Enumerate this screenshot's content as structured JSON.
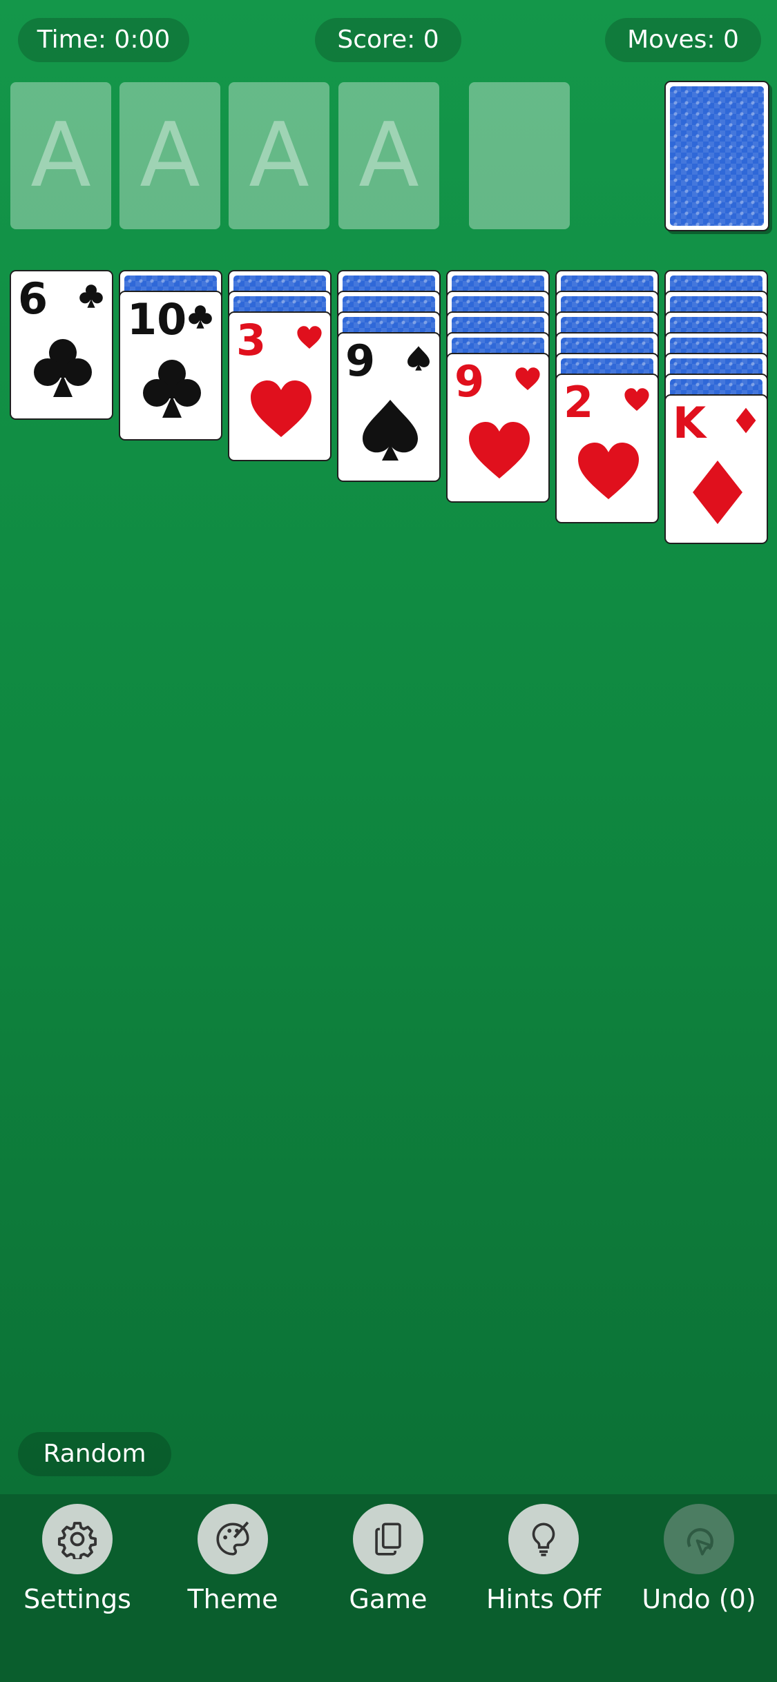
{
  "stats": {
    "time": "Time: 0:00",
    "score": "Score: 0",
    "moves": "Moves: 0"
  },
  "foundations": [
    "A",
    "A",
    "A",
    "A"
  ],
  "colors": {
    "felt": "#14974a",
    "red_suit": "#e0101d",
    "card_back": "#2f68d8"
  },
  "tableau": [
    {
      "face_down": 0,
      "rank": "6",
      "suit": "clubs",
      "color": "black"
    },
    {
      "face_down": 1,
      "rank": "10",
      "suit": "clubs",
      "color": "black"
    },
    {
      "face_down": 2,
      "rank": "3",
      "suit": "hearts",
      "color": "red"
    },
    {
      "face_down": 3,
      "rank": "9",
      "suit": "spades",
      "color": "black"
    },
    {
      "face_down": 4,
      "rank": "9",
      "suit": "hearts",
      "color": "red"
    },
    {
      "face_down": 5,
      "rank": "2",
      "suit": "hearts",
      "color": "red"
    },
    {
      "face_down": 6,
      "rank": "K",
      "suit": "diamonds",
      "color": "red"
    }
  ],
  "mode_label": "Random",
  "toolbar": {
    "settings": "Settings",
    "theme": "Theme",
    "game": "Game",
    "hints": "Hints Off",
    "undo": "Undo (0)"
  }
}
